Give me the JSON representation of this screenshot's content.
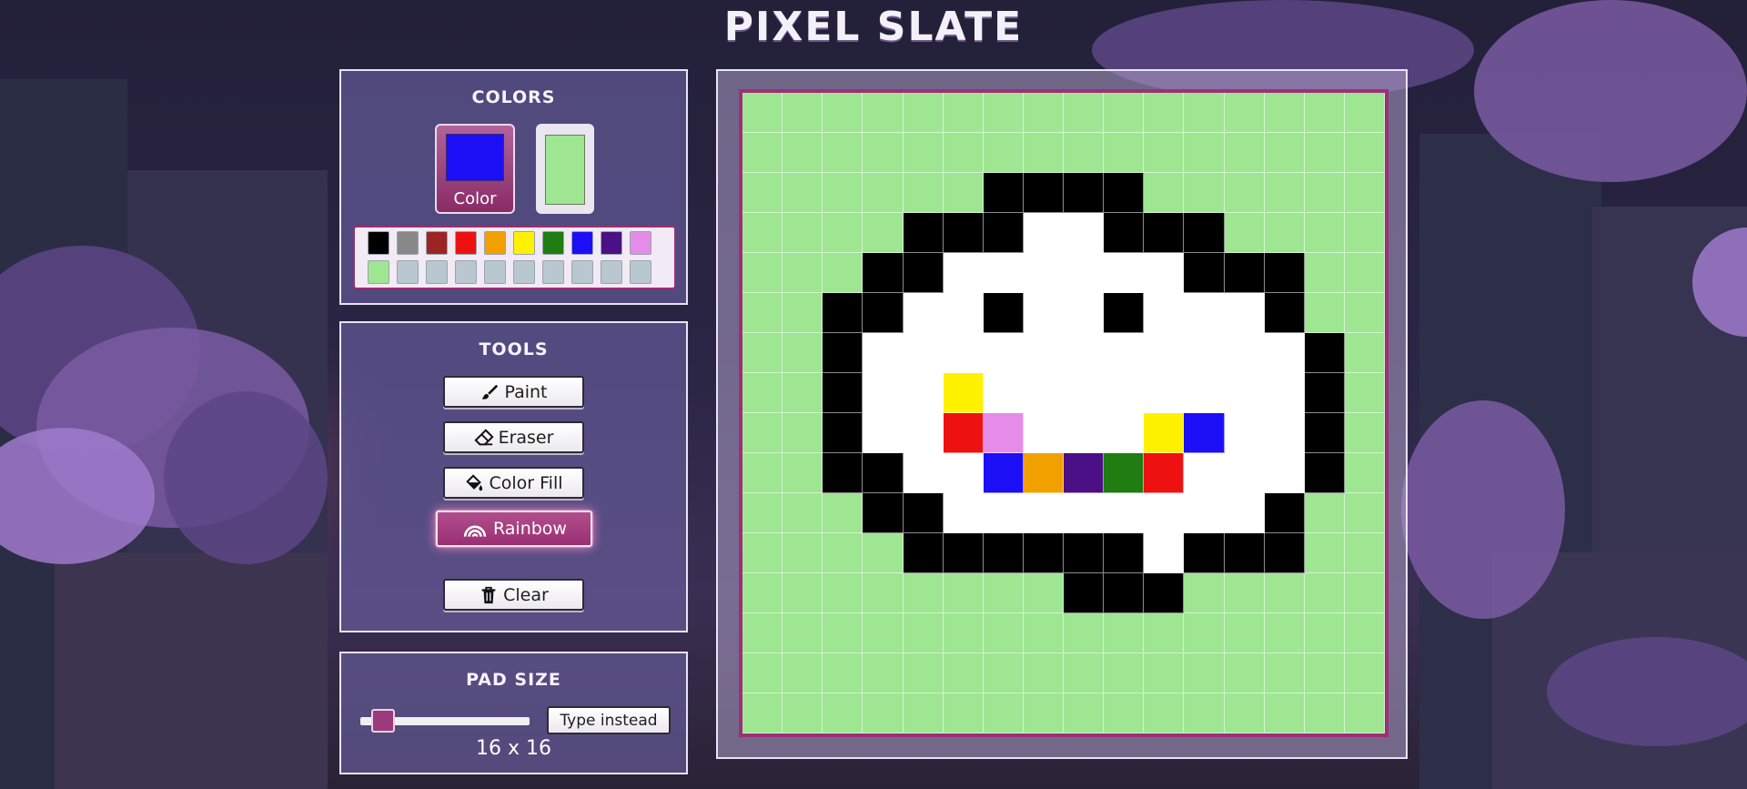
{
  "app": {
    "title": "PIXEL SLATE"
  },
  "colors_panel": {
    "title": "COLORS",
    "primary": {
      "label": "Color",
      "color": "#1c0ff5"
    },
    "secondary": {
      "color": "#9ee692"
    },
    "palette": [
      "#000000",
      "#888888",
      "#9c2424",
      "#ee1111",
      "#f2a000",
      "#fff200",
      "#1f7d12",
      "#1c0ff5",
      "#4b1085",
      "#e58ce8",
      "#9ee692",
      "#b9c7d1",
      "#b9c7d1",
      "#b9c7d1",
      "#b9c7d1",
      "#b9c7d1",
      "#b9c7d1",
      "#b9c7d1",
      "#b9c7d1",
      "#b9c7d1"
    ]
  },
  "tools_panel": {
    "title": "TOOLS",
    "tools": [
      {
        "label": "Paint",
        "icon": "paintbrush-icon",
        "active": false
      },
      {
        "label": "Eraser",
        "icon": "eraser-icon",
        "active": false
      },
      {
        "label": "Color Fill",
        "icon": "paint-bucket-icon",
        "active": false
      },
      {
        "label": "Rainbow",
        "icon": "rainbow-icon",
        "active": true
      },
      {
        "label": "Clear",
        "icon": "trash-icon",
        "active": false
      }
    ]
  },
  "pad_size_panel": {
    "title": "PAD SIZE",
    "slider_value": 16,
    "type_button_label": "Type instead",
    "readout": "16 x 16"
  },
  "canvas": {
    "rows": 16,
    "cols": 16,
    "background": "#9ee692",
    "legend": {
      "G": "#9ee692",
      "K": "#000000",
      "W": "#ffffff",
      "Y": "#fff200",
      "R": "#ee1111",
      "P": "#e58ce8",
      "B": "#1c0ff5",
      "O": "#f2a000",
      "V": "#4b1085",
      "N": "#1f7d12"
    },
    "pixels": [
      "GGGGGGGGGGGGGGGG",
      "GGGGGGGGGGGGGGGG",
      "GGGGGGKKKKGGGGGG",
      "GGGGKKKWWKKKGGGG",
      "GGGKKWWWWWWKKKGG",
      "GGKKWWKWWKWWWKGG",
      "GGKWWWWWWWWWWWKG",
      "GGKWWYWWWWWWWWKG",
      "GGKWWRPWWWYBWWKG",
      "GGKKWWBOVNRWWWKG",
      "GGGKKWWWWWWWWKGG",
      "GGGGKKKKKKWKKKGG",
      "GGGGGGGGKKKGGGGG",
      "GGGGGGGGGGGGGGGG",
      "GGGGGGGGGGGGGGGG",
      "GGGGGGGGGGGGGGGG"
    ]
  }
}
